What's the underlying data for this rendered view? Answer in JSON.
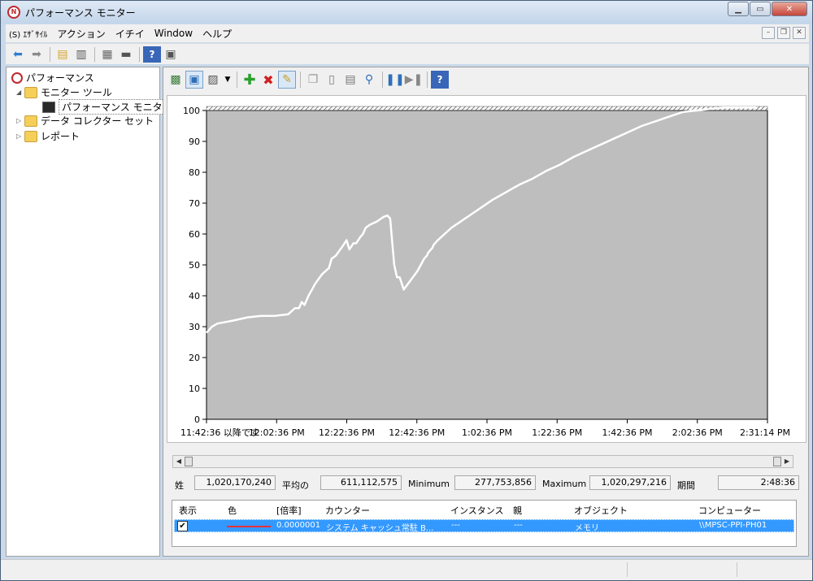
{
  "window": {
    "title": "パフォーマンス モニター"
  },
  "menu": {
    "items": [
      "(S) ｴｻﾞｻｲﾙ",
      "アクション",
      "イチイ",
      "Window",
      "ヘルプ"
    ]
  },
  "tree": {
    "root": "パフォーマンス",
    "monitor_tools": "モニター ツール",
    "perf_monitor": "パフォーマンス モニター",
    "collector_sets": "データ コレクター セット",
    "reports": "レポート"
  },
  "stats": {
    "last_label": "姓",
    "last_value": "1,020,170,240",
    "avg_label": "平均の",
    "avg_value": "611,112,575",
    "min_label": "Minimum",
    "min_value": "277,753,856",
    "max_label": "Maximum",
    "max_value": "1,020,297,216",
    "duration_label": "期間",
    "duration_value": "2:48:36"
  },
  "legend": {
    "headers": [
      "表示",
      "色",
      "[倍率]",
      "カウンター",
      "インスタンス",
      "親",
      "オブジェクト",
      "コンピューター"
    ],
    "row": {
      "show_check": "✔",
      "scale": "0.0000001",
      "counter": "システム キャッシュ常駐 B...",
      "instance": "---",
      "parent": "---",
      "object": "メモリ",
      "computer": "\\\\MPSC-PPI-PH01"
    },
    "line_color": "#e8303a"
  },
  "chart_data": {
    "type": "line",
    "ylim": [
      0,
      100
    ],
    "yticks": [
      0,
      10,
      20,
      30,
      40,
      50,
      60,
      70,
      80,
      90,
      100
    ],
    "xticks": [
      "11:42:36 以降です",
      "12:02:36 PM",
      "12:22:36 PM",
      "12:42:36 PM",
      "1:02:36 PM",
      "1:22:36 PM",
      "1:42:36 PM",
      "2:02:36 PM",
      "2:31:14 PM"
    ],
    "background_color": "#bebebe",
    "line_color": "#ffffff",
    "grid": false,
    "series": [
      {
        "x": [
          0,
          4,
          8,
          20,
          30,
          40,
          50,
          60,
          65,
          68,
          70,
          72,
          75,
          80,
          85,
          90,
          92,
          95,
          100,
          103,
          105,
          108,
          110,
          113,
          115,
          117,
          120,
          125,
          130,
          133,
          135,
          138,
          140,
          142,
          145,
          150,
          155,
          160,
          162,
          163,
          164,
          165,
          166,
          167,
          170,
          175,
          180,
          185,
          190,
          200,
          210,
          220,
          230,
          240,
          250,
          260,
          270,
          280,
          290,
          300,
          310,
          320,
          330,
          340,
          350,
          360,
          370,
          380,
          390,
          400,
          404
        ],
        "y": [
          28,
          30,
          31,
          32,
          33,
          33.5,
          33.5,
          34,
          36,
          36,
          38,
          37,
          40,
          44,
          47,
          49,
          52,
          53,
          56,
          58,
          55,
          57,
          57,
          59,
          60,
          62,
          63,
          64,
          65.5,
          66,
          65,
          50,
          46,
          46,
          42,
          45,
          48,
          52,
          53,
          54,
          54.5,
          55,
          55.5,
          56.5,
          58,
          60,
          62,
          63.5,
          65,
          68,
          71,
          73.5,
          76,
          78,
          80.5,
          82.5,
          85,
          87,
          89,
          91,
          93,
          95,
          96.5,
          98,
          99.5,
          100,
          100.5,
          101,
          101,
          101,
          101
        ]
      }
    ]
  }
}
